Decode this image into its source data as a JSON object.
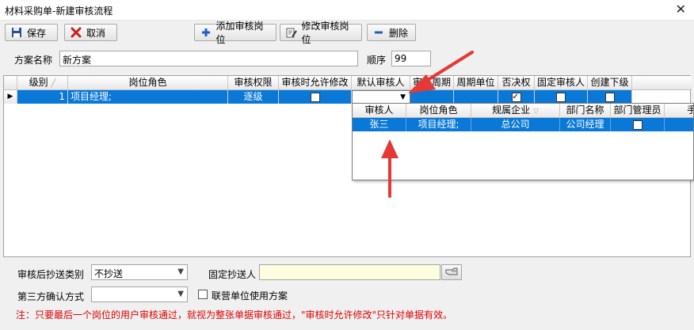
{
  "window": {
    "title": "材料采购单-新建审核流程",
    "close": "✕"
  },
  "toolbar": {
    "save": "保存",
    "cancel": "取消",
    "add_position": "添加审核岗位",
    "edit_position": "修改审核岗位",
    "delete": "删除"
  },
  "plan": {
    "name_label": "方案名称",
    "name_value": "新方案",
    "order_label": "顺序",
    "order_value": "99"
  },
  "grid": {
    "columns": [
      "级别",
      "岗位角色",
      "审核权限",
      "审核时允许修改",
      "默认审核人",
      "审核周期",
      "周期单位",
      "否决权",
      "固定审核人",
      "创建下级"
    ],
    "rows": [
      {
        "level": "1",
        "role": "项目经理;",
        "permission": "逐级",
        "allow_edit": false,
        "default_reviewer": "",
        "cycle": "",
        "cycle_unit": "",
        "veto": true,
        "fixed_reviewer": false,
        "create_sub": false
      }
    ]
  },
  "popup": {
    "columns": [
      "审核人",
      "岗位角色",
      "规属企业",
      "部门名称",
      "部门管理员",
      "手"
    ],
    "rows": [
      {
        "reviewer": "张三",
        "role": "项目经理;",
        "company": "总公司",
        "dept": "公司经理",
        "dept_admin": false
      }
    ]
  },
  "bottom": {
    "cc_type_label": "审核后抄送类别",
    "cc_type_value": "不抄送",
    "fixed_cc_label": "固定抄送人",
    "fixed_cc_value": "",
    "third_party_label": "第三方确认方式",
    "third_party_value": "",
    "joint_label": "联营单位使用方案",
    "joint_checked": false
  },
  "note": "注：只要最后一个岗位的用户审核通过，就视为整张单据审核通过，\"审核时允许修改\"只针对单据有效。",
  "colors": {
    "selection": "#0a78d7",
    "arrow": "#e53935",
    "note": "#e00000"
  }
}
